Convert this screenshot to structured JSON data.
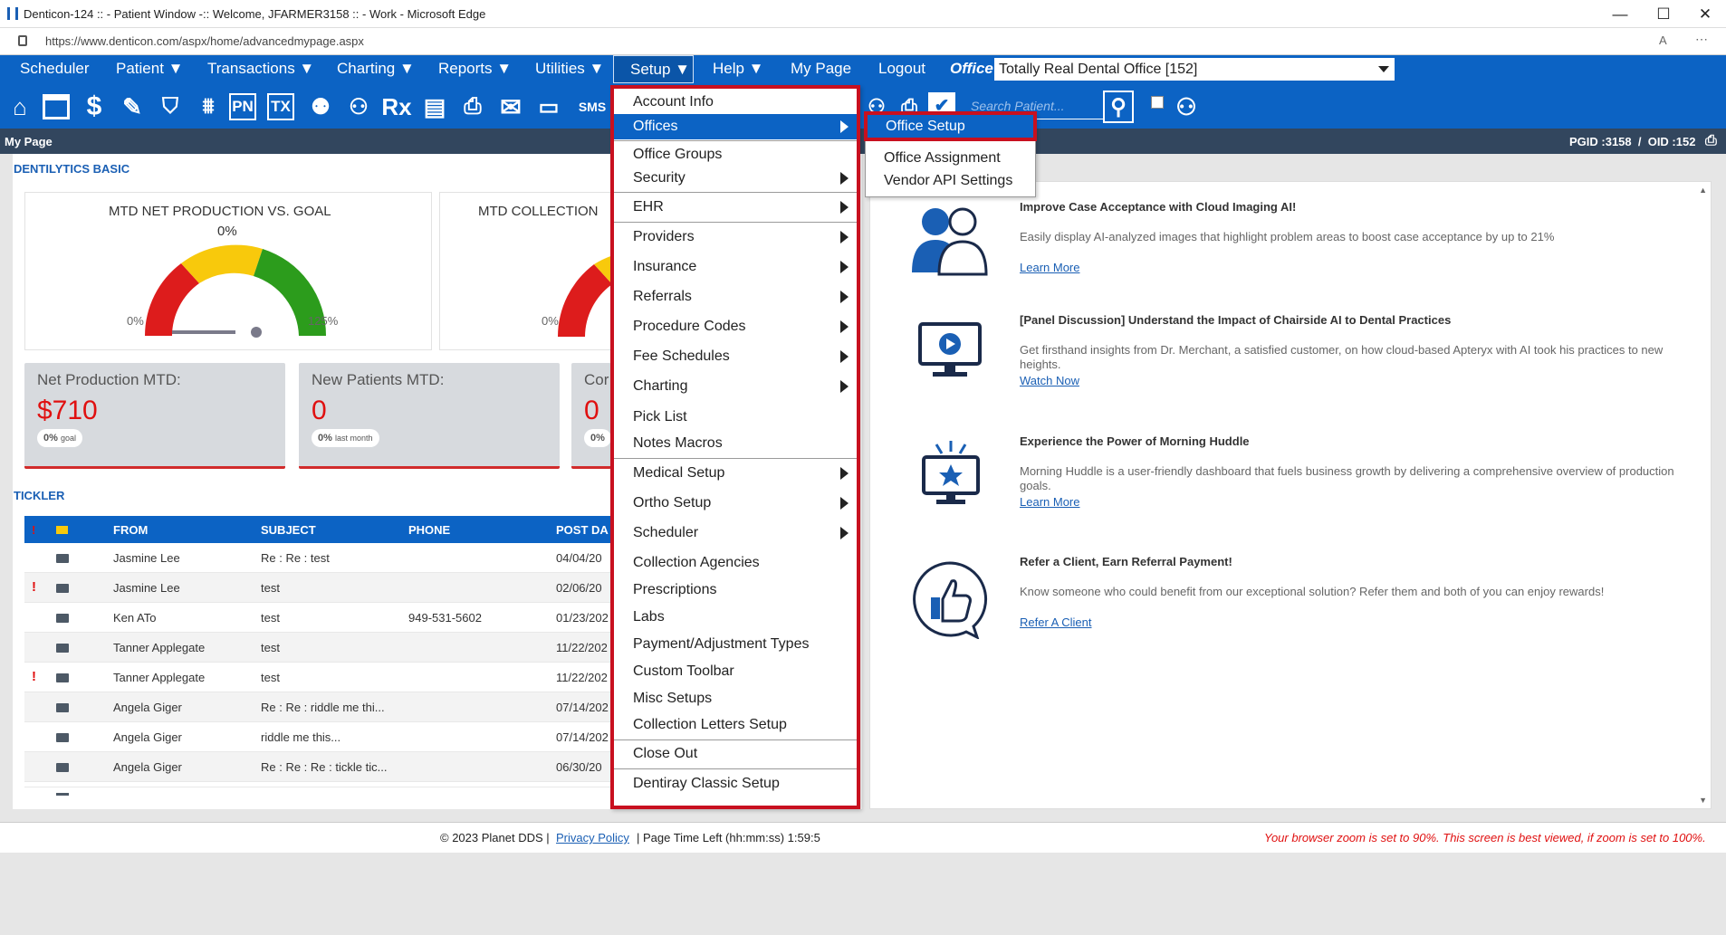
{
  "window": {
    "title": "Denticon-124 :: - Patient Window -:: Welcome, JFARMER3158 :: - Work - Microsoft Edge",
    "url": "https://www.denticon.com/aspx/home/advancedmypage.aspx",
    "minimize": "—",
    "maximize": "☐",
    "close": "✕"
  },
  "menu": {
    "items": [
      "Scheduler",
      "Patient ▼",
      "Transactions ▼",
      "Charting ▼",
      "Reports ▼",
      "Utilities ▼",
      "Setup ▼",
      "Help ▼",
      "My Page",
      "Logout"
    ],
    "office_label": "Office",
    "office_value": "Totally Real Dental Office [152]"
  },
  "toolbar": {
    "search_placeholder": "Search Patient...",
    "sms": "SMS",
    "pn": "PN",
    "tx": "TX",
    "rx": "Rx"
  },
  "pagebar": {
    "title": "My Page",
    "ids": "PGID :3158  /  OID :152"
  },
  "dashboard": {
    "section": "DENTILYTICS BASIC",
    "gauge1": {
      "title": "MTD NET PRODUCTION VS. GOAL",
      "value": "0%",
      "min": "0%",
      "max": "125%",
      "level": 0
    },
    "gauge2": {
      "title": "MTD COLLECTION",
      "min": "0%"
    },
    "kpis": [
      {
        "label": "Net Production MTD:",
        "value": "$710",
        "pill_num": "0%",
        "pill_txt": "goal"
      },
      {
        "label": "New Patients MTD:",
        "value": "0",
        "pill_num": "0%",
        "pill_txt": "last month"
      },
      {
        "label": "Cor",
        "value": "0",
        "pill_num": "0%",
        "pill_txt": ""
      }
    ]
  },
  "tickler": {
    "section": "TICKLER",
    "headers": {
      "from": "FROM",
      "subject": "SUBJECT",
      "phone": "PHONE",
      "post": "POST DA"
    },
    "rows": [
      {
        "urgent": "",
        "from": "Jasmine Lee",
        "subject": "Re : Re : test",
        "phone": "",
        "date": "04/04/20"
      },
      {
        "urgent": "!",
        "from": "Jasmine Lee",
        "subject": "test",
        "phone": "",
        "date": "02/06/20"
      },
      {
        "urgent": "",
        "from": "Ken ATo",
        "subject": "test",
        "phone": "949-531-5602",
        "date": "01/23/202"
      },
      {
        "urgent": "",
        "from": "Tanner Applegate",
        "subject": "test",
        "phone": "",
        "date": "11/22/202"
      },
      {
        "urgent": "!",
        "from": "Tanner Applegate",
        "subject": "test",
        "phone": "",
        "date": "11/22/202"
      },
      {
        "urgent": "",
        "from": "Angela Giger",
        "subject": "Re : Re : riddle me thi...",
        "phone": "",
        "date": "07/14/202"
      },
      {
        "urgent": "",
        "from": "Angela Giger",
        "subject": "riddle me this...",
        "phone": "",
        "date": "07/14/202"
      },
      {
        "urgent": "",
        "from": "Angela Giger",
        "subject": "Re : Re : Re : tickle tic...",
        "phone": "",
        "date": "06/30/20"
      }
    ]
  },
  "news": [
    {
      "title": "Improve Case Acceptance with Cloud Imaging AI!",
      "body": "Easily display AI-analyzed images that highlight problem areas to boost case acceptance by up to 21%",
      "link": "Learn More"
    },
    {
      "title": "[Panel Discussion] Understand the Impact of Chairside AI to Dental Practices",
      "body": "Get firsthand insights from Dr. Merchant, a satisfied customer, on how cloud-based Apteryx with AI took his practices to new heights.",
      "link": "Watch Now"
    },
    {
      "title": "Experience the Power of Morning Huddle",
      "body": "Morning Huddle is a user-friendly dashboard that fuels business growth by delivering a comprehensive overview of production goals.",
      "link": "Learn More"
    },
    {
      "title": "Refer a Client, Earn Referral Payment!",
      "body": "Know someone who could benefit from our exceptional solution? Refer them and both of you can enjoy rewards!",
      "link": "Refer A Client"
    }
  ],
  "setup_menu": {
    "items": [
      "Account Info",
      "Offices",
      "Office Groups",
      "Security",
      "EHR",
      "Providers",
      "Insurance",
      "Referrals",
      "Procedure Codes",
      "Fee Schedules",
      "Charting",
      "Pick List",
      "Notes Macros",
      "Medical Setup",
      "Ortho Setup",
      "Scheduler",
      "Collection Agencies",
      "Prescriptions",
      "Labs",
      "Payment/Adjustment Types",
      "Custom Toolbar",
      "Misc Setups",
      "Collection Letters Setup",
      "Close Out",
      "Dentiray Classic Setup"
    ]
  },
  "offices_submenu": {
    "items": [
      "Office Setup",
      "Office Assignment",
      "Vendor API Settings"
    ]
  },
  "footer": {
    "copyright": "© 2023 Planet DDS |",
    "privacy": "Privacy Policy",
    "time_left": "| Page Time Left (hh:mm:ss) 1:59:5",
    "zoom_warning": "Your browser zoom is set to 90%. This screen is best viewed, if zoom is set to 100%."
  },
  "colors": {
    "brand_blue": "#0c63c4",
    "highlight_red": "#c8101f",
    "value_red": "#e01010"
  }
}
